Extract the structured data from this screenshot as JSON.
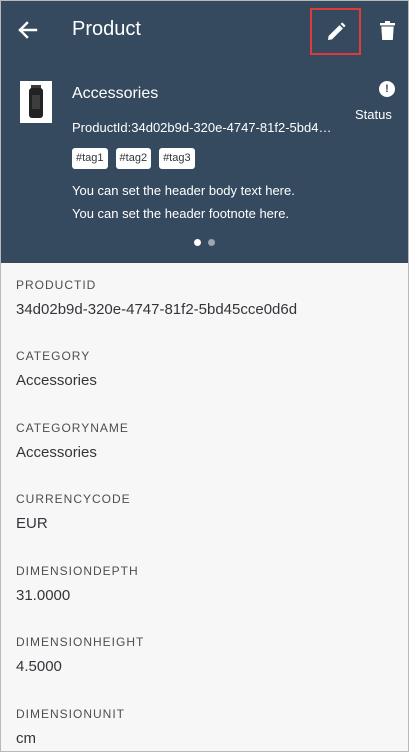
{
  "header": {
    "title": "Product",
    "product_title": "Accessories",
    "product_subtitle": "ProductId:34d02b9d-320e-4747-81f2-5bd45cce0d6d",
    "status_label": "Status",
    "tags": [
      "#tag1",
      "#tag2",
      "#tag3"
    ],
    "body_text": "You can set the header body text here.",
    "footnote_text": "You can set the header footnote here.",
    "page_indicator": {
      "total": 2,
      "active": 1
    }
  },
  "icons": {
    "back": "arrow-left-icon",
    "edit": "pencil-icon",
    "delete": "trash-icon",
    "status": "exclamation-circle-icon"
  },
  "colors": {
    "header_bg": "#354a5f",
    "highlight_border": "#e03b3b",
    "content_bg": "#f7f7f7"
  },
  "fields": [
    {
      "label": "PRODUCTID",
      "value": "34d02b9d-320e-4747-81f2-5bd45cce0d6d"
    },
    {
      "label": "CATEGORY",
      "value": "Accessories"
    },
    {
      "label": "CATEGORYNAME",
      "value": "Accessories"
    },
    {
      "label": "CURRENCYCODE",
      "value": "EUR"
    },
    {
      "label": "DIMENSIONDEPTH",
      "value": "31.0000"
    },
    {
      "label": "DIMENSIONHEIGHT",
      "value": "4.5000"
    },
    {
      "label": "DIMENSIONUNIT",
      "value": "cm"
    }
  ]
}
